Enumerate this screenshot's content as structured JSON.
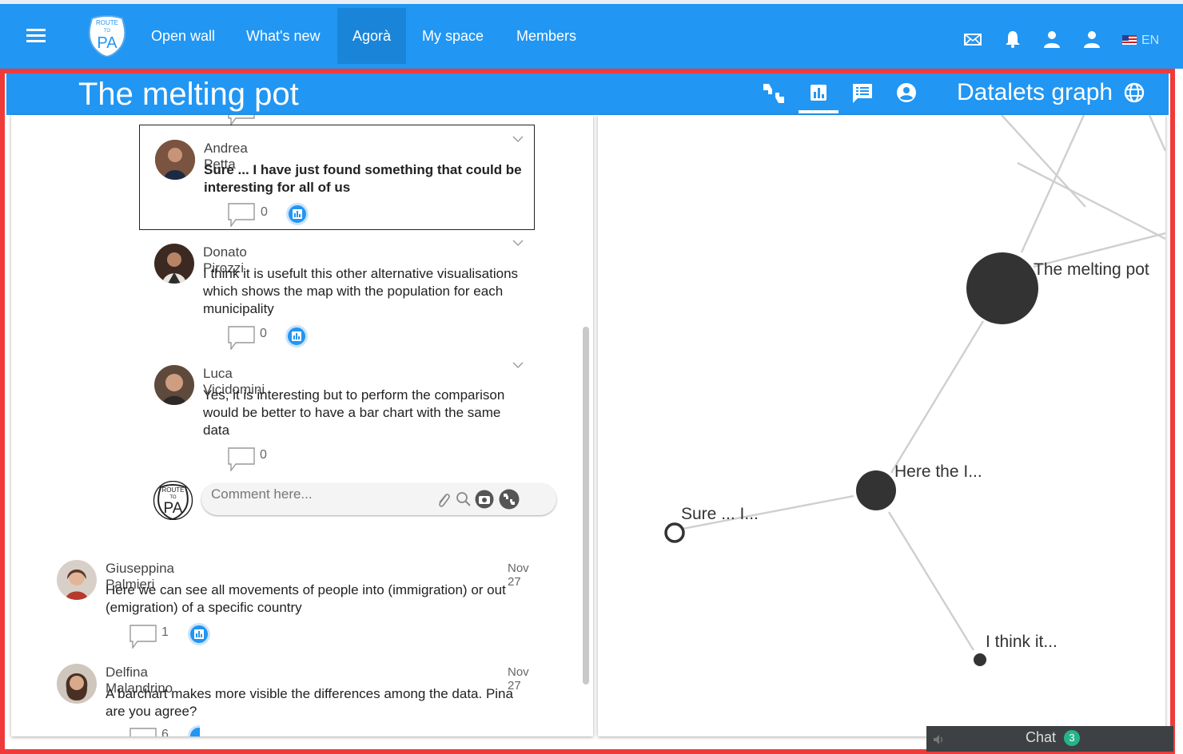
{
  "topnav": {
    "items": [
      {
        "label": "Open wall"
      },
      {
        "label": "What's new"
      },
      {
        "label": "Agorà"
      },
      {
        "label": "My space"
      },
      {
        "label": "Members"
      }
    ],
    "active": "Agorà",
    "logo_text": [
      "ROUTE",
      "TO",
      "PA"
    ],
    "language": "EN",
    "icons": [
      "menu-icon",
      "mail-icon",
      "bell-icon",
      "user-icon",
      "user-icon"
    ]
  },
  "titlebar": {
    "title": "The melting pot",
    "graph_title": "Datalets graph",
    "icons": [
      "thumbs-icon",
      "bar-chart-icon",
      "list-icon",
      "account-icon",
      "globe-icon"
    ],
    "active_icon": "bar-chart-icon"
  },
  "comments": [
    {
      "author": "Andrea Petta",
      "text": "Sure ... I have just found something that could be interesting for all of us",
      "replies": "0",
      "has_datalet": true,
      "highlighted": true
    },
    {
      "author": "Donato Pirozzi",
      "text": "I think it is usefult this other alternative visualisations which shows the map with the population for each municipality",
      "replies": "0",
      "has_datalet": true
    },
    {
      "author": "Luca Vicidomini",
      "text": "Yes, it is interesting but to perform the comparison would be better to have a bar chart with the same data",
      "replies": "0",
      "has_datalet": false
    },
    {
      "author": "Giuseppina Palmieri",
      "date": "Nov 27",
      "text": "Here we can see all movements of people into (immigration) or out (emigration) of a specific country",
      "replies": "1",
      "has_datalet": true
    },
    {
      "author": "Delfina Malandrino",
      "date": "Nov 27",
      "text": "A barchart makes more visible the differences among the data. Pina are you agree?",
      "replies": "6",
      "has_datalet": true
    }
  ],
  "comment_input": {
    "placeholder": "Comment here...",
    "icons": [
      "attach-icon",
      "search-icon",
      "camera-icon",
      "thumbs-icon"
    ]
  },
  "graph": {
    "nodes": [
      {
        "label": "The melting pot",
        "size": "large"
      },
      {
        "label": "Here the I...",
        "size": "medium"
      },
      {
        "label": "Sure ... I...",
        "size": "small-outline"
      },
      {
        "label": "I think it...",
        "size": "small"
      }
    ]
  },
  "chat": {
    "label": "Chat",
    "count": "3"
  },
  "colors": {
    "primary": "#2196f3",
    "active_nav": "#1a85d8",
    "frame": "#f03a3a",
    "node": "#333333",
    "edge": "#cfcfcf",
    "chat_badge": "#26b38a"
  }
}
